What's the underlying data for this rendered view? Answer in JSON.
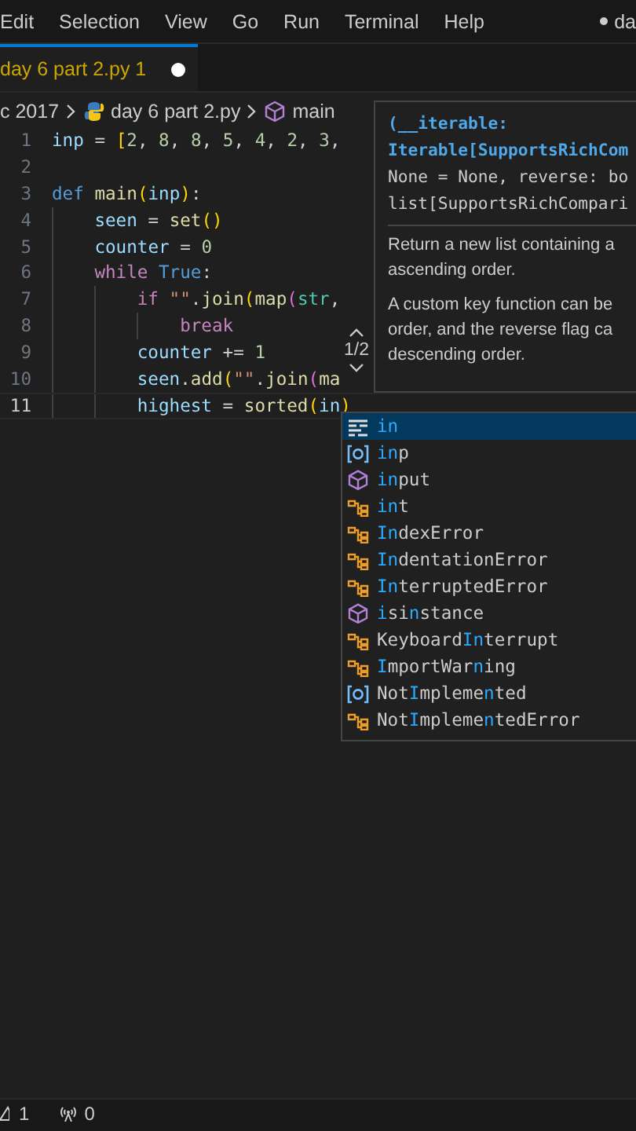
{
  "menu_bar": {
    "items": [
      "Edit",
      "Selection",
      "View",
      "Go",
      "Run",
      "Terminal",
      "Help"
    ],
    "title": "da",
    "title_dirty": true
  },
  "tabs": [
    {
      "label": "day 6 part 2.py",
      "problems": "1",
      "dirty": true,
      "selected": true
    }
  ],
  "breadcrumb": [
    {
      "kind": "folder",
      "label": "c 2017"
    },
    {
      "kind": "python",
      "label": "day 6 part 2.py"
    },
    {
      "kind": "symbol",
      "label": "main"
    }
  ],
  "editor": {
    "lines": [
      {
        "number": "1",
        "current": false,
        "tokens": [
          {
            "kind": "var",
            "text": "inp"
          },
          {
            "kind": "op",
            "text": " = "
          },
          {
            "kind": "bracket",
            "text": "["
          },
          {
            "kind": "num",
            "text": "2"
          },
          {
            "kind": "op",
            "text": ", "
          },
          {
            "kind": "num",
            "text": "8"
          },
          {
            "kind": "op",
            "text": ", "
          },
          {
            "kind": "num",
            "text": "8"
          },
          {
            "kind": "op",
            "text": ", "
          },
          {
            "kind": "num",
            "text": "5"
          },
          {
            "kind": "op",
            "text": ", "
          },
          {
            "kind": "num",
            "text": "4"
          },
          {
            "kind": "op",
            "text": ", "
          },
          {
            "kind": "num",
            "text": "2"
          },
          {
            "kind": "op",
            "text": ", "
          },
          {
            "kind": "num",
            "text": "3"
          },
          {
            "kind": "op",
            "text": ","
          }
        ]
      },
      {
        "number": "2",
        "current": false
      },
      {
        "number": "3",
        "current": false,
        "tokens": [
          {
            "kind": "def",
            "text": "def "
          },
          {
            "kind": "func",
            "text": "main"
          },
          {
            "kind": "bracket",
            "text": "("
          },
          {
            "kind": "var",
            "text": "inp"
          },
          {
            "kind": "bracket",
            "text": ")"
          },
          {
            "kind": "op",
            "text": ":"
          }
        ],
        "children": [
          {
            "number": "4",
            "current": false,
            "tokens": [
              {
                "kind": "var",
                "text": "seen"
              },
              {
                "kind": "op",
                "text": " = "
              },
              {
                "kind": "func",
                "text": "set"
              },
              {
                "kind": "bracket",
                "text": "()"
              }
            ]
          },
          {
            "number": "5",
            "current": false,
            "tokens": [
              {
                "kind": "var",
                "text": "counter"
              },
              {
                "kind": "op",
                "text": " = "
              },
              {
                "kind": "num",
                "text": "0"
              }
            ]
          },
          {
            "number": "6",
            "current": false,
            "tokens": [
              {
                "kind": "keyword",
                "text": "while "
              },
              {
                "kind": "def",
                "text": "True"
              },
              {
                "kind": "op",
                "text": ":"
              }
            ],
            "children": [
              {
                "number": "7",
                "current": false,
                "tokens": [
                  {
                    "kind": "keyword",
                    "text": "if "
                  },
                  {
                    "kind": "str",
                    "text": "\"\""
                  },
                  {
                    "kind": "op",
                    "text": "."
                  },
                  {
                    "kind": "func",
                    "text": "join"
                  },
                  {
                    "kind": "bracket",
                    "text": "("
                  },
                  {
                    "kind": "func",
                    "text": "map"
                  },
                  {
                    "kind": "bracket2",
                    "text": "("
                  },
                  {
                    "kind": "class",
                    "text": "str"
                  },
                  {
                    "kind": "op",
                    "text": ","
                  }
                ],
                "children": [
                  {
                    "number": "8",
                    "current": false,
                    "tokens": [
                      {
                        "kind": "keyword",
                        "text": "break"
                      }
                    ]
                  }
                ]
              },
              {
                "number": "9",
                "current": false,
                "tokens": [
                  {
                    "kind": "var",
                    "text": "counter"
                  },
                  {
                    "kind": "op",
                    "text": " += "
                  },
                  {
                    "kind": "num",
                    "text": "1"
                  }
                ]
              },
              {
                "number": "10",
                "current": false,
                "tokens": [
                  {
                    "kind": "var",
                    "text": "seen"
                  },
                  {
                    "kind": "op",
                    "text": "."
                  },
                  {
                    "kind": "func",
                    "text": "add"
                  },
                  {
                    "kind": "bracket",
                    "text": "("
                  },
                  {
                    "kind": "str",
                    "text": "\"\""
                  },
                  {
                    "kind": "op",
                    "text": "."
                  },
                  {
                    "kind": "func",
                    "text": "join"
                  },
                  {
                    "kind": "bracket2",
                    "text": "("
                  },
                  {
                    "kind": "func",
                    "text": "ma"
                  }
                ]
              },
              {
                "number": "11",
                "current": true,
                "tokens": [
                  {
                    "kind": "var",
                    "text": "highest"
                  },
                  {
                    "kind": "op",
                    "text": " = "
                  },
                  {
                    "kind": "func",
                    "text": "sorted"
                  },
                  {
                    "kind": "bracket",
                    "text": "("
                  },
                  {
                    "kind": "var",
                    "text": "in"
                  },
                  {
                    "kind": "bracket",
                    "text": ")"
                  }
                ]
              }
            ]
          }
        ]
      }
    ]
  },
  "hover": {
    "signature": [
      "(__iterable:",
      "Iterable[SupportsRichCom",
      "None = None, reverse: bo",
      "list[SupportsRichCompari"
    ],
    "docs": [
      "Return a new list containing a ascending order.",
      "A custom key function can be order, and the reverse flag ca descending order."
    ],
    "overload": "1/2"
  },
  "suggestions": [
    {
      "kind": "keyword",
      "selected": true,
      "parts": [
        {
          "text": "in",
          "match": true
        }
      ]
    },
    {
      "kind": "variable",
      "selected": false,
      "parts": [
        {
          "text": "in",
          "match": true
        },
        {
          "text": "p",
          "match": false
        }
      ]
    },
    {
      "kind": "function",
      "selected": false,
      "parts": [
        {
          "text": "in",
          "match": true
        },
        {
          "text": "put",
          "match": false
        }
      ]
    },
    {
      "kind": "class",
      "selected": false,
      "parts": [
        {
          "text": "in",
          "match": true
        },
        {
          "text": "t",
          "match": false
        }
      ]
    },
    {
      "kind": "class",
      "selected": false,
      "parts": [
        {
          "text": "In",
          "match": true
        },
        {
          "text": "dexError",
          "match": false
        }
      ]
    },
    {
      "kind": "class",
      "selected": false,
      "parts": [
        {
          "text": "In",
          "match": true
        },
        {
          "text": "dentationError",
          "match": false
        }
      ]
    },
    {
      "kind": "class",
      "selected": false,
      "parts": [
        {
          "text": "In",
          "match": true
        },
        {
          "text": "terruptedError",
          "match": false
        }
      ]
    },
    {
      "kind": "function",
      "selected": false,
      "parts": [
        {
          "text": "i",
          "match": true
        },
        {
          "text": "si",
          "match": false
        },
        {
          "text": "n",
          "match": true
        },
        {
          "text": "stance",
          "match": false
        }
      ]
    },
    {
      "kind": "class",
      "selected": false,
      "parts": [
        {
          "text": "Keyboard",
          "match": false
        },
        {
          "text": "In",
          "match": true
        },
        {
          "text": "terrupt",
          "match": false
        }
      ]
    },
    {
      "kind": "class",
      "selected": false,
      "parts": [
        {
          "text": "I",
          "match": true
        },
        {
          "text": "mportWar",
          "match": false
        },
        {
          "text": "n",
          "match": true
        },
        {
          "text": "ing",
          "match": false
        }
      ]
    },
    {
      "kind": "variable",
      "selected": false,
      "parts": [
        {
          "text": "Not",
          "match": false
        },
        {
          "text": "I",
          "match": true
        },
        {
          "text": "mpleme",
          "match": false
        },
        {
          "text": "n",
          "match": true
        },
        {
          "text": "ted",
          "match": false
        }
      ]
    },
    {
      "kind": "class",
      "selected": false,
      "parts": [
        {
          "text": "Not",
          "match": false
        },
        {
          "text": "I",
          "match": true
        },
        {
          "text": "mpleme",
          "match": false
        },
        {
          "text": "n",
          "match": true
        },
        {
          "text": "tedError",
          "match": false
        }
      ]
    }
  ],
  "status_bar": {
    "warnings": "1",
    "ports": "0"
  }
}
